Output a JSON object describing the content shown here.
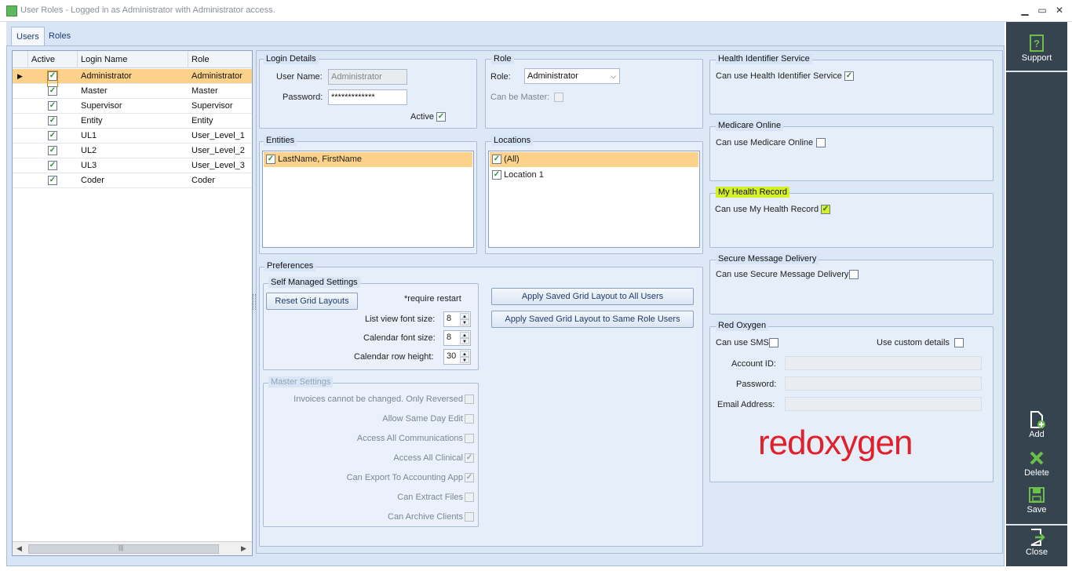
{
  "window": {
    "title": "User Roles - Logged in as Administrator with Administrator access.",
    "minimize": "▁",
    "maximize": "▭",
    "close": "✕"
  },
  "tabs": [
    {
      "label": "Users"
    },
    {
      "label": "Roles"
    }
  ],
  "users_grid": {
    "columns": [
      "Active",
      "Login Name",
      "Role"
    ],
    "rows": [
      {
        "active": true,
        "login": "Administrator",
        "role": "Administrator"
      },
      {
        "active": true,
        "login": "Master",
        "role": "Master"
      },
      {
        "active": true,
        "login": "Supervisor",
        "role": "Supervisor"
      },
      {
        "active": true,
        "login": "Entity",
        "role": "Entity"
      },
      {
        "active": true,
        "login": "UL1",
        "role": "User_Level_1"
      },
      {
        "active": true,
        "login": "UL2",
        "role": "User_Level_2"
      },
      {
        "active": true,
        "login": "UL3",
        "role": "User_Level_3"
      },
      {
        "active": true,
        "login": "Coder",
        "role": "Coder"
      }
    ],
    "scrollbar_grip": "|||"
  },
  "login_details": {
    "title": "Login Details",
    "username_label": "User Name:",
    "username_value": "Administrator",
    "password_label": "Password:",
    "password_value": "*************",
    "active_label": "Active"
  },
  "role": {
    "title": "Role",
    "role_label": "Role:",
    "role_value": "Administrator",
    "can_be_master_label": "Can be Master:"
  },
  "entities": {
    "title": "Entities",
    "items": [
      {
        "label": "LastName, FirstName",
        "checked": true
      }
    ]
  },
  "locations": {
    "title": "Locations",
    "items": [
      {
        "label": "(All)",
        "checked": true
      },
      {
        "label": "Location 1",
        "checked": true
      }
    ]
  },
  "preferences": {
    "title": "Preferences",
    "self_managed": {
      "title": "Self Managed Settings",
      "reset_button": "Reset Grid Layouts",
      "restart_note": "*require restart",
      "list_font_label": "List view font size:",
      "list_font_value": "8",
      "calendar_font_label": "Calendar font size:",
      "calendar_font_value": "8",
      "calendar_row_label": "Calendar row height:",
      "calendar_row_value": "30"
    },
    "apply_all_button": "Apply Saved Grid Layout to All Users",
    "apply_role_button": "Apply Saved Grid Layout to Same Role Users",
    "master_settings": {
      "title": "Master Settings",
      "items": [
        {
          "label": "Invoices cannot be changed. Only Reversed",
          "checked": false
        },
        {
          "label": "Allow Same Day Edit",
          "checked": false
        },
        {
          "label": "Access All Communications",
          "checked": false
        },
        {
          "label": "Access All Clinical",
          "checked": true
        },
        {
          "label": "Can Export To Accounting App",
          "checked": true
        },
        {
          "label": "Can Extract Files",
          "checked": false
        },
        {
          "label": "Can Archive Clients",
          "checked": false
        }
      ]
    }
  },
  "his": {
    "title": "Health Identifier Service",
    "label": "Can use Health Identifier Service",
    "checked": true
  },
  "medicare": {
    "title": "Medicare Online",
    "label": "Can use Medicare Online",
    "checked": false
  },
  "mhr": {
    "title": "My Health Record",
    "label": "Can use My Health Record",
    "checked": true
  },
  "smd": {
    "title": "Secure Message Delivery",
    "label": "Can use Secure Message Delivery",
    "checked": false
  },
  "red_oxygen": {
    "title": "Red Oxygen",
    "sms_label": "Can use SMS",
    "custom_label": "Use custom details",
    "account_label": "Account ID:",
    "password_label": "Password:",
    "email_label": "Email Address:",
    "logo_text_red": "red",
    "logo_text_oxygen": "oxygen"
  },
  "sidebar": {
    "support": "Support",
    "add": "Add",
    "delete": "Delete",
    "save": "Save",
    "close": "Close"
  },
  "colors": {
    "accent": "#35444f",
    "selection": "#fcd28a",
    "panel": "#d7e5f7",
    "logo_red": "#e0202a",
    "highlight": "#d4f02a"
  }
}
